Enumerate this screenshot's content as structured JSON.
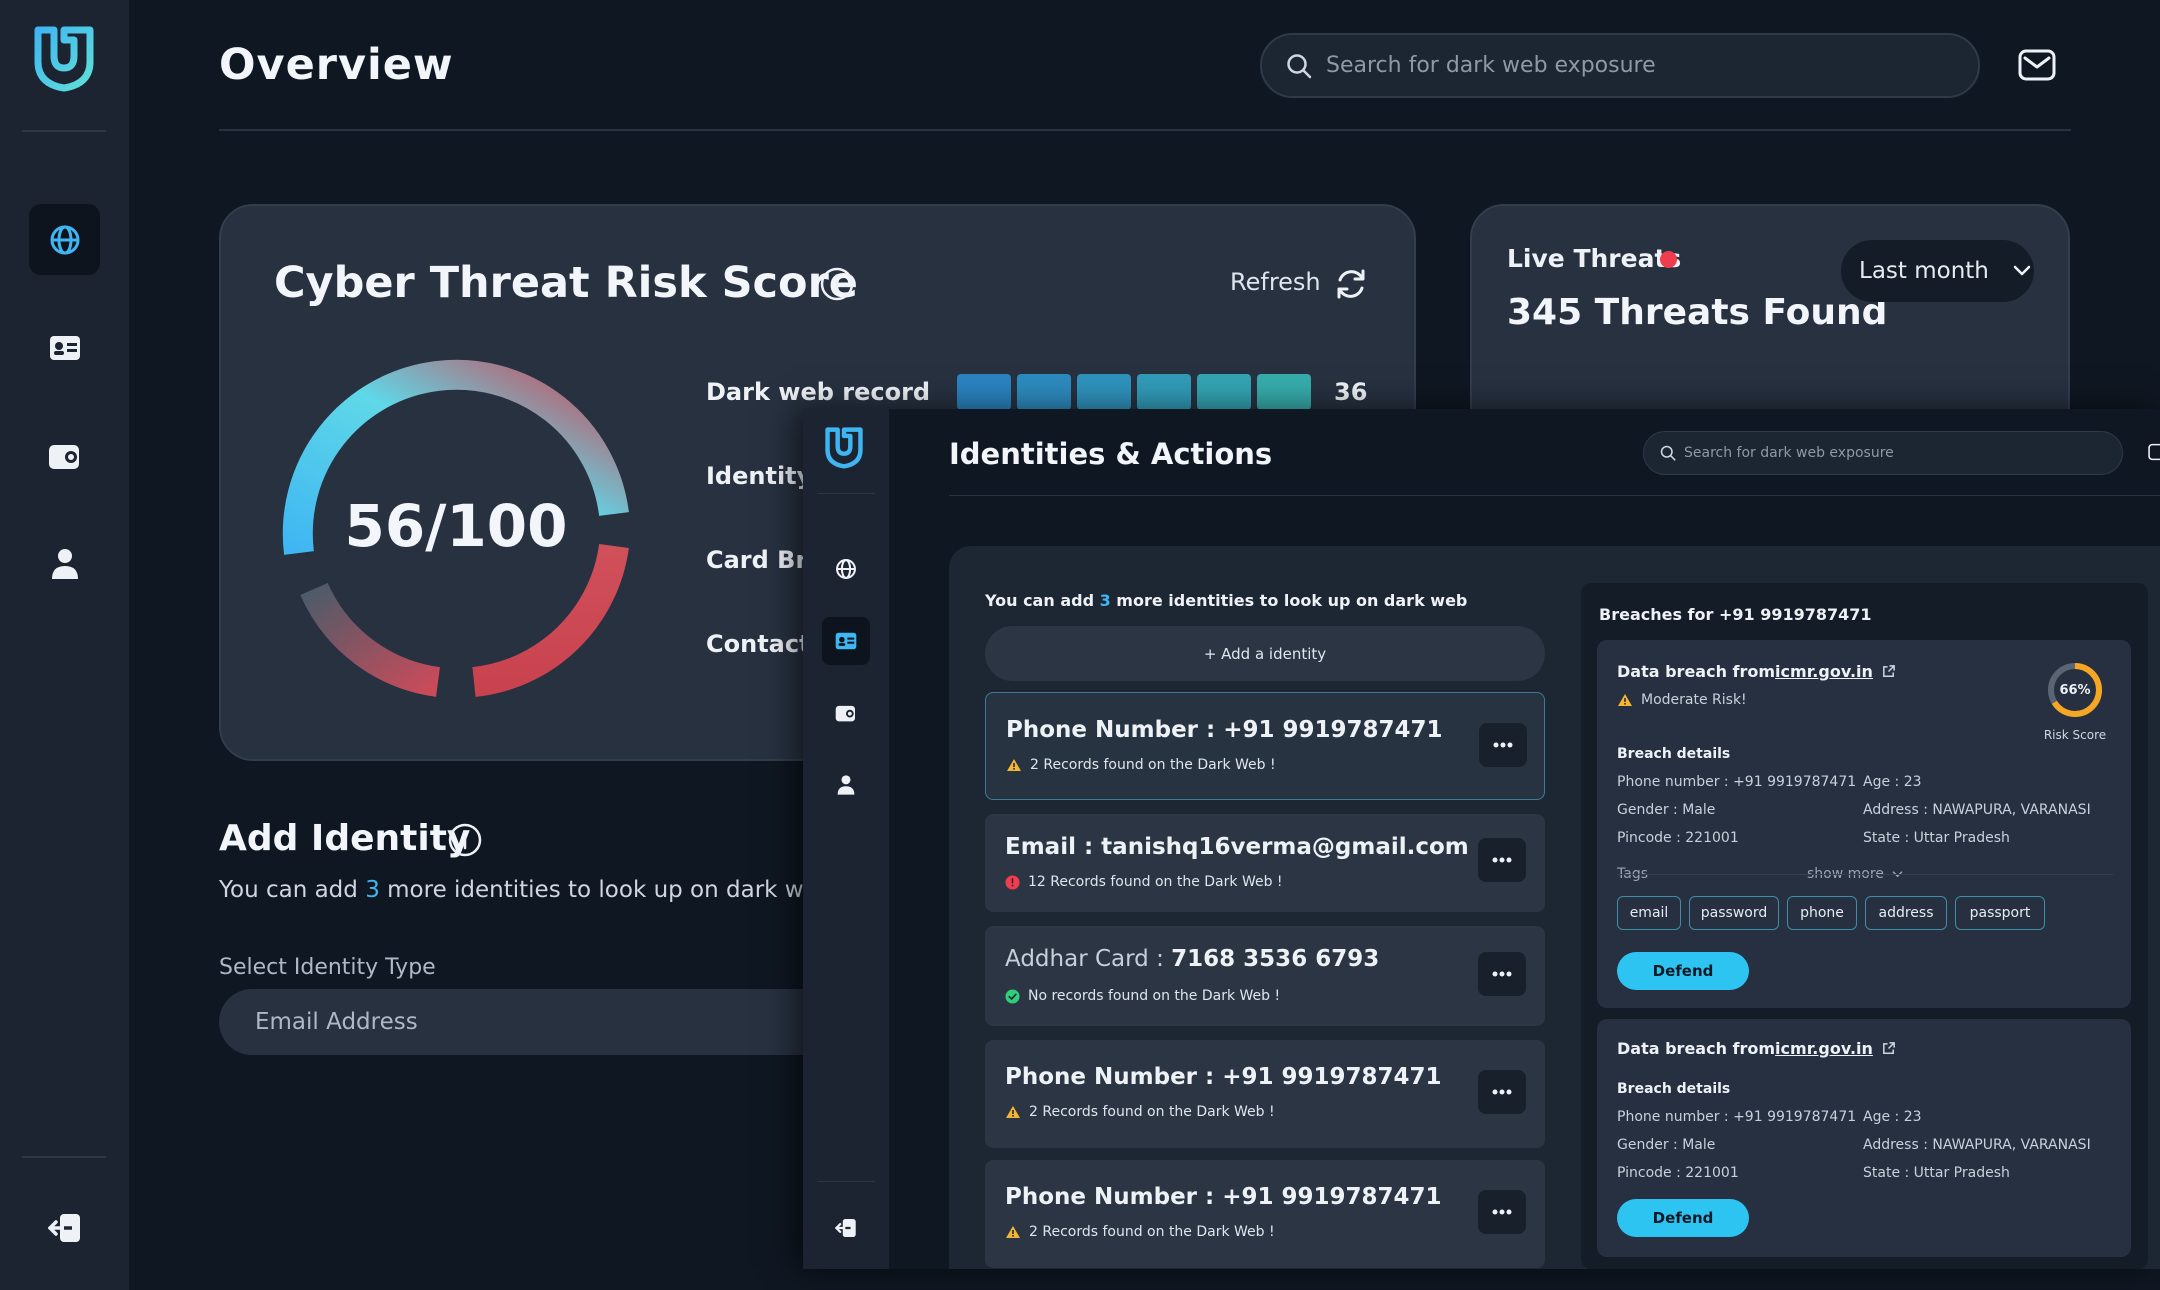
{
  "header": {
    "title": "Overview",
    "search_placeholder": "Search for dark web exposure"
  },
  "sidebar": {
    "items": [
      {
        "icon": "globe-icon",
        "active": true
      },
      {
        "icon": "id-card-icon",
        "active": false
      },
      {
        "icon": "wallet-icon",
        "active": false
      },
      {
        "icon": "user-icon",
        "active": false
      }
    ],
    "logout_icon": "logout-icon"
  },
  "risk": {
    "title": "Cyber Threat Risk Score",
    "refresh_label": "Refresh",
    "score": "56/100",
    "metrics": [
      {
        "label": "Dark web record",
        "value": "36",
        "filled_segments": 6
      },
      {
        "label": "Identity I"
      },
      {
        "label": "Card Bre"
      },
      {
        "label": "Contact"
      }
    ]
  },
  "live": {
    "title": "Live Threats",
    "period": "Last month",
    "count": "345 Threats Found"
  },
  "add_identity": {
    "title": "Add Identity",
    "sub_pre": "You can add ",
    "sub_num": "3",
    "sub_post": " more identities to look up on dark web",
    "select_label": "Select Identity Type",
    "select_value": "Email Address"
  },
  "overlay": {
    "title": "Identities & Actions",
    "search_placeholder": "Search for dark web exposure",
    "hint_pre": "You can add ",
    "hint_num": "3",
    "hint_post": " more identities to look up on dark web",
    "add_button": "+ Add a identity",
    "identities": [
      {
        "prefix": "",
        "name": "Phone Number : +91 9919787471",
        "note": "2 Records found on the Dark Web !",
        "status": "warning"
      },
      {
        "prefix": "",
        "name": "Email : tanishq16verma@gmail.com",
        "note": "12 Records found on the Dark Web !",
        "status": "danger"
      },
      {
        "prefix": "Addhar Card : ",
        "name": "7168 3536 6793",
        "note": "No records found on the Dark Web !",
        "status": "ok"
      },
      {
        "prefix": "",
        "name": "Phone Number : +91 9919787471",
        "note": "2 Records found on the Dark Web !",
        "status": "warning"
      },
      {
        "prefix": "",
        "name": "Phone Number : +91 9919787471",
        "note": "2 Records found on the Dark Web !",
        "status": "warning"
      }
    ],
    "breaches": {
      "heading": "Breaches for +91 9919787471",
      "cards": [
        {
          "title_pre": "Data breach from ",
          "link": "icmr.gov.in",
          "risk": "Moderate Risk!",
          "score": "66%",
          "score_label": "Risk Score",
          "section": "Breach details",
          "phone": "Phone number : +91 9919787471",
          "age": "Age : 23",
          "gender": "Gender : Male",
          "address": "Address : NAWAPURA, VARANASI",
          "pincode": "Pincode : 221001",
          "state": "State : Uttar Pradesh",
          "tags_label": "Tags",
          "show_more": "show more",
          "tags": [
            "email",
            "password",
            "phone",
            "address",
            "passport"
          ],
          "defend": "Defend"
        },
        {
          "title_pre": "Data breach from ",
          "link": "icmr.gov.in",
          "section": "Breach details",
          "phone": "Phone number : +91 9919787471",
          "age": "Age : 23",
          "gender": "Gender : Male",
          "address": "Address : NAWAPURA, VARANASI",
          "pincode": "Pincode : 221001",
          "state": "State : Uttar Pradesh",
          "defend": "Defend"
        }
      ]
    }
  },
  "colors": {
    "accent": "#3fb6f2",
    "danger": "#ef3d4e",
    "warning": "#f5b731",
    "ok": "#2fcf7a"
  }
}
